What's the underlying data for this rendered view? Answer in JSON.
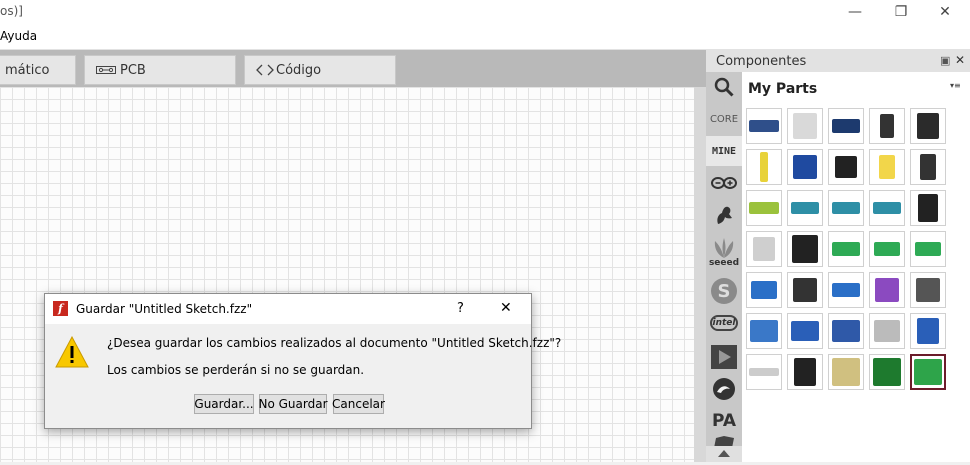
{
  "window": {
    "title": "os)]",
    "minimize_glyph": "—",
    "maximize_glyph": "❐",
    "close_glyph": "✕"
  },
  "menu": {
    "items": [
      "Ayuda"
    ]
  },
  "tabs": [
    {
      "label": "mático",
      "icon": "schematic-icon"
    },
    {
      "label": "PCB",
      "icon": "pcb-icon"
    },
    {
      "label": "Código",
      "icon": "code-icon"
    }
  ],
  "components_panel": {
    "title": "Componentes",
    "float_glyph": "▣",
    "close_glyph": "✕",
    "bin_title": "My Parts",
    "bins": [
      {
        "label": "",
        "icon": "search-icon"
      },
      {
        "label": "CORE",
        "icon": ""
      },
      {
        "label": "MINE",
        "icon": ""
      },
      {
        "label": "",
        "icon": "arduino-icon"
      },
      {
        "label": "",
        "icon": "fritzing-hand-icon"
      },
      {
        "label": "seeed",
        "icon": "seeed-icon"
      },
      {
        "label": "S",
        "icon": "sparkfun-icon"
      },
      {
        "label": "intel",
        "icon": "intel-icon"
      },
      {
        "label": "",
        "icon": "play-icon"
      },
      {
        "label": "",
        "icon": "snootlab-icon"
      },
      {
        "label": "PA",
        "icon": "pa-icon"
      }
    ],
    "parts_rows": 7,
    "parts_cols": 5,
    "selected_part": 34
  },
  "dialog": {
    "title": "Guardar \"Untitled Sketch.fzz\"",
    "help_glyph": "?",
    "close_glyph": "✕",
    "message": "¿Desea guardar los cambios realizados al documento \"Untitled Sketch.fzz\"?",
    "detail": "Los cambios se perderán si no se guardan.",
    "buttons": {
      "save": "Guardar...",
      "dont_save": "No Guardar",
      "cancel": "Cancelar"
    }
  }
}
